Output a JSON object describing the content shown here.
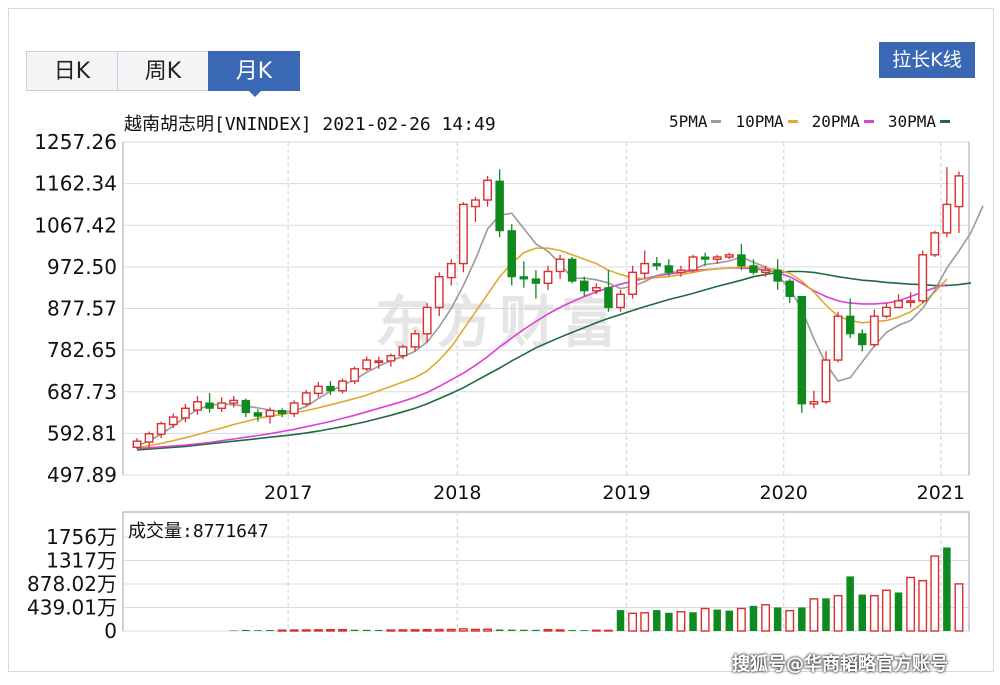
{
  "tabs": [
    {
      "label": "日K",
      "active": false
    },
    {
      "label": "周K",
      "active": false
    },
    {
      "label": "月K",
      "active": true
    }
  ],
  "stretch_button": "拉长K线",
  "chart_title": "越南胡志明[VNINDEX] 2021-02-26 14:49",
  "volume_title": "成交量:8771647",
  "watermark": "东方财富",
  "footer_watermark": "搜狐号@华商韬略官方账号",
  "colors": {
    "up": "#d9302f",
    "down": "#0f8a1f",
    "ma5": "#9a9a9a",
    "ma10": "#e0a92d",
    "ma20": "#de3fd6",
    "ma30": "#1f6b3c",
    "accent": "#3a68b4",
    "grid": "#d7dbe2"
  },
  "chart_data": [
    {
      "type": "candlestick",
      "title": "越南胡志明[VNINDEX] 2021-02-26 14:49",
      "y_ticks": [
        "1257.26",
        "1162.34",
        "1067.42",
        "972.50",
        "877.57",
        "782.65",
        "687.73",
        "592.81",
        "497.89"
      ],
      "ylim": [
        497.89,
        1257.26
      ],
      "x_ticks": [
        "2017",
        "2018",
        "2019",
        "2020",
        "2021"
      ],
      "legend": [
        {
          "name": "5PMA",
          "color": "#9a9a9a"
        },
        {
          "name": "10PMA",
          "color": "#e0a92d"
        },
        {
          "name": "20PMA",
          "color": "#de3fd6"
        },
        {
          "name": "30PMA",
          "color": "#1f6b3c"
        }
      ],
      "candles": [
        [
          561,
          575,
          557,
          582
        ],
        [
          573,
          592,
          560,
          597
        ],
        [
          591,
          615,
          582,
          620
        ],
        [
          613,
          630,
          605,
          638
        ],
        [
          628,
          650,
          618,
          660
        ],
        [
          646,
          665,
          635,
          678
        ],
        [
          662,
          650,
          640,
          685
        ],
        [
          650,
          662,
          642,
          675
        ],
        [
          662,
          668,
          652,
          678
        ],
        [
          668,
          640,
          630,
          672
        ],
        [
          640,
          632,
          620,
          648
        ],
        [
          632,
          645,
          615,
          652
        ],
        [
          645,
          638,
          630,
          650
        ],
        [
          638,
          662,
          630,
          668
        ],
        [
          660,
          685,
          655,
          692
        ],
        [
          684,
          700,
          675,
          710
        ],
        [
          700,
          690,
          680,
          712
        ],
        [
          690,
          712,
          684,
          718
        ],
        [
          712,
          740,
          705,
          745
        ],
        [
          740,
          760,
          735,
          768
        ],
        [
          758,
          758,
          740,
          768
        ],
        [
          758,
          770,
          745,
          775
        ],
        [
          770,
          790,
          762,
          795
        ],
        [
          790,
          820,
          780,
          828
        ],
        [
          820,
          880,
          800,
          890
        ],
        [
          880,
          950,
          860,
          960
        ],
        [
          948,
          980,
          930,
          990
        ],
        [
          980,
          1115,
          960,
          1120
        ],
        [
          1110,
          1125,
          1075,
          1132
        ],
        [
          1125,
          1170,
          1110,
          1180
        ],
        [
          1168,
          1055,
          1040,
          1195
        ],
        [
          1055,
          950,
          930,
          1070
        ],
        [
          950,
          945,
          925,
          985
        ],
        [
          945,
          935,
          900,
          965
        ],
        [
          935,
          962,
          920,
          975
        ],
        [
          962,
          990,
          945,
          1000
        ],
        [
          990,
          940,
          935,
          995
        ],
        [
          940,
          918,
          905,
          950
        ],
        [
          918,
          925,
          910,
          935
        ],
        [
          925,
          880,
          870,
          965
        ],
        [
          880,
          910,
          870,
          920
        ],
        [
          910,
          960,
          900,
          975
        ],
        [
          958,
          980,
          945,
          1010
        ],
        [
          980,
          975,
          965,
          995
        ],
        [
          975,
          960,
          952,
          990
        ],
        [
          960,
          965,
          950,
          975
        ],
        [
          965,
          995,
          960,
          1000
        ],
        [
          995,
          990,
          975,
          1005
        ],
        [
          990,
          995,
          980,
          1000
        ],
        [
          995,
          1000,
          990,
          1005
        ],
        [
          1000,
          975,
          965,
          1025
        ],
        [
          975,
          960,
          955,
          990
        ],
        [
          960,
          965,
          950,
          975
        ],
        [
          965,
          940,
          920,
          990
        ],
        [
          940,
          905,
          890,
          945
        ],
        [
          905,
          660,
          640,
          905
        ],
        [
          660,
          665,
          650,
          690
        ],
        [
          665,
          760,
          660,
          780
        ],
        [
          760,
          860,
          755,
          870
        ],
        [
          860,
          820,
          810,
          900
        ],
        [
          820,
          795,
          780,
          830
        ],
        [
          795,
          860,
          790,
          875
        ],
        [
          860,
          880,
          855,
          890
        ],
        [
          880,
          895,
          880,
          910
        ],
        [
          895,
          895,
          880,
          915
        ],
        [
          895,
          1000,
          890,
          1010
        ],
        [
          1000,
          1050,
          995,
          1055
        ],
        [
          1050,
          1115,
          1040,
          1200
        ],
        [
          1110,
          1180,
          1050,
          1190
        ]
      ],
      "ma5": [
        564,
        576,
        591,
        610,
        630,
        647,
        657,
        660,
        658,
        655,
        651,
        646,
        641,
        644,
        654,
        672,
        689,
        703,
        715,
        732,
        746,
        759,
        768,
        780,
        801,
        836,
        878,
        930,
        990,
        1059,
        1090,
        1095,
        1060,
        1025,
        1008,
        980,
        946,
        947,
        943,
        936,
        923,
        928,
        939,
        953,
        959,
        962,
        967,
        978,
        981,
        986,
        995,
        983,
        972,
        953,
        923,
        876,
        808,
        751,
        712,
        720,
        756,
        792,
        823,
        839,
        850,
        878,
        919,
        970,
        1009,
        1051,
        1112
      ],
      "ma10": [
        560,
        565,
        570,
        576,
        583,
        590,
        598,
        605,
        613,
        620,
        627,
        632,
        636,
        640,
        645,
        651,
        658,
        665,
        672,
        680,
        690,
        700,
        710,
        720,
        735,
        760,
        790,
        830,
        870,
        910,
        950,
        980,
        1005,
        1015,
        1015,
        1010,
        1000,
        990,
        980,
        965,
        955,
        948,
        945,
        948,
        950,
        955,
        960,
        965,
        968,
        970,
        972,
        972,
        970,
        966,
        958,
        940,
        915,
        885,
        860,
        850,
        845,
        848,
        850,
        858,
        870,
        890,
        915,
        945
      ],
      "ma20": [
        558,
        560,
        562,
        564,
        566,
        569,
        572,
        576,
        580,
        584,
        588,
        592,
        597,
        602,
        608,
        614,
        620,
        627,
        634,
        642,
        650,
        658,
        666,
        675,
        686,
        700,
        715,
        730,
        748,
        768,
        790,
        810,
        830,
        848,
        865,
        880,
        893,
        905,
        915,
        925,
        933,
        940,
        946,
        952,
        956,
        960,
        964,
        966,
        968,
        970,
        970,
        968,
        965,
        960,
        950,
        935,
        918,
        905,
        895,
        890,
        888,
        888,
        890,
        895,
        905,
        915,
        925,
        932
      ],
      "ma30": [
        555,
        557,
        559,
        561,
        563,
        566,
        569,
        572,
        575,
        578,
        581,
        584,
        587,
        590,
        594,
        598,
        603,
        608,
        614,
        620,
        627,
        634,
        642,
        650,
        660,
        672,
        684,
        697,
        712,
        727,
        742,
        758,
        773,
        788,
        800,
        812,
        823,
        834,
        845,
        855,
        864,
        873,
        882,
        890,
        898,
        905,
        912,
        920,
        928,
        935,
        942,
        950,
        955,
        960,
        962,
        962,
        960,
        955,
        950,
        946,
        942,
        940,
        937,
        935,
        933,
        932,
        930,
        930,
        932,
        936
      ]
    },
    {
      "type": "bar",
      "title": "成交量:8771647",
      "y_ticks": [
        "1756万",
        "1317万",
        "878.02万",
        "439.01万",
        "0"
      ],
      "ylim": [
        0,
        1756
      ],
      "unit": "万",
      "values": [
        0,
        0,
        0,
        0,
        0,
        0,
        0,
        0,
        10,
        20,
        15,
        18,
        16,
        18,
        20,
        22,
        24,
        26,
        24,
        22,
        20,
        18,
        20,
        22,
        25,
        28,
        30,
        40,
        30,
        32,
        28,
        26,
        24,
        22,
        25,
        20,
        18,
        16,
        14,
        12,
        390,
        330,
        340,
        390,
        340,
        360,
        350,
        420,
        400,
        380,
        420,
        470,
        490,
        440,
        380,
        440,
        600,
        610,
        660,
        1020,
        680,
        660,
        760,
        720,
        1000,
        940,
        1400,
        1560,
        880
      ],
      "up": [
        0,
        0,
        0,
        0,
        0,
        0,
        0,
        0,
        0,
        0,
        0,
        0,
        1,
        1,
        1,
        1,
        1,
        1,
        0,
        0,
        0,
        1,
        1,
        1,
        1,
        1,
        1,
        1,
        1,
        1,
        0,
        0,
        0,
        0,
        1,
        1,
        0,
        0,
        1,
        1,
        0,
        1,
        1,
        0,
        0,
        1,
        0,
        1,
        0,
        0,
        1,
        0,
        1,
        0,
        1,
        0,
        1,
        0,
        1,
        0,
        0,
        1,
        1,
        0,
        1,
        1,
        1,
        0,
        1
      ]
    }
  ]
}
